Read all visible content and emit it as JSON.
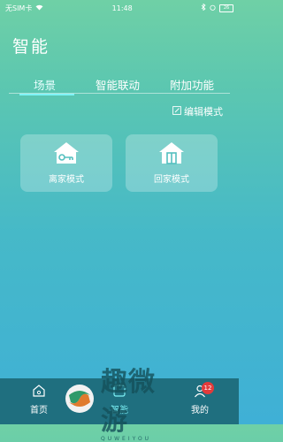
{
  "status_bar": {
    "carrier": "无SIM卡",
    "time": "11:48",
    "battery": "26"
  },
  "page_title": "智能",
  "tabs": [
    {
      "label": "场景",
      "active": true
    },
    {
      "label": "智能联动",
      "active": false
    },
    {
      "label": "附加功能",
      "active": false
    }
  ],
  "edit_mode_label": "编辑模式",
  "scenes": [
    {
      "label": "离家模式",
      "icon": "house-key-icon"
    },
    {
      "label": "回家模式",
      "icon": "house-door-icon"
    }
  ],
  "bottom_nav": {
    "items": [
      {
        "label": "首页",
        "icon": "home-icon"
      },
      {
        "label": "智能",
        "icon": "smart-icon"
      },
      {
        "label": "我的",
        "icon": "profile-icon"
      }
    ],
    "badge_count": "12"
  },
  "watermark": {
    "title": "趣微游",
    "subtitle": "QUWEIYOU"
  },
  "colors": {
    "accent_tab": "#7ff3f7",
    "nav_bg": "#1f6f7f",
    "badge": "#e23b3b"
  }
}
